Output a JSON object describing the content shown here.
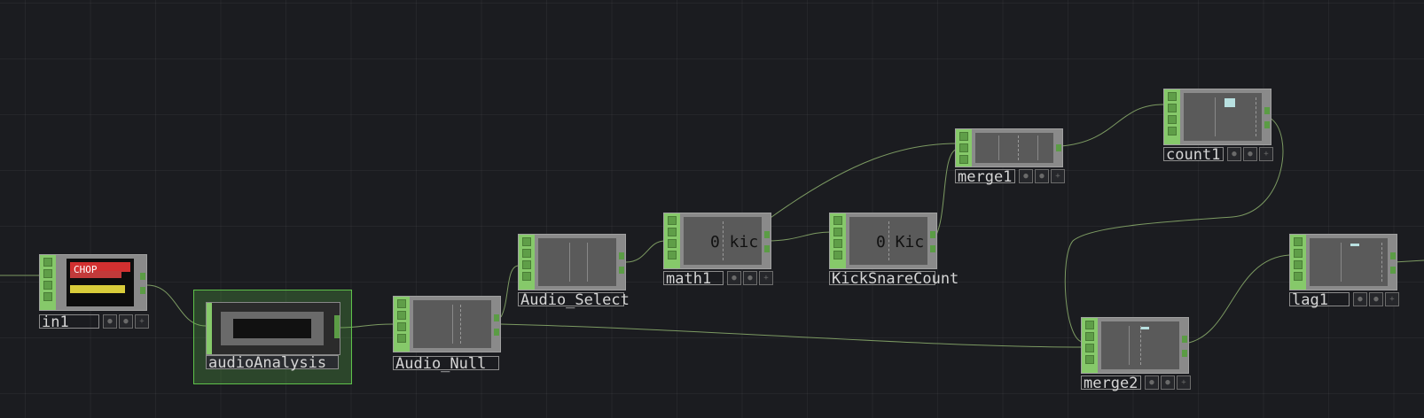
{
  "nodes": {
    "in1": {
      "label": "in1",
      "preview_text": "CHOP"
    },
    "audioAnalysis": {
      "label": "audioAnalysis"
    },
    "audio_null": {
      "label": "Audio_Null"
    },
    "audio_select": {
      "label": "Audio_Select"
    },
    "math1": {
      "label": "math1",
      "display": "0 kic"
    },
    "kicksnarecount": {
      "label": "KickSnareCount",
      "display": "0 Kic"
    },
    "merge1": {
      "label": "merge1"
    },
    "count1": {
      "label": "count1"
    },
    "merge2": {
      "label": "merge2"
    },
    "lag1": {
      "label": "lag1"
    }
  },
  "colors": {
    "background": "#1b1c20",
    "operator_rail": "#86c96a",
    "wire": "#7fa85e",
    "selected": "#5ec24a"
  }
}
